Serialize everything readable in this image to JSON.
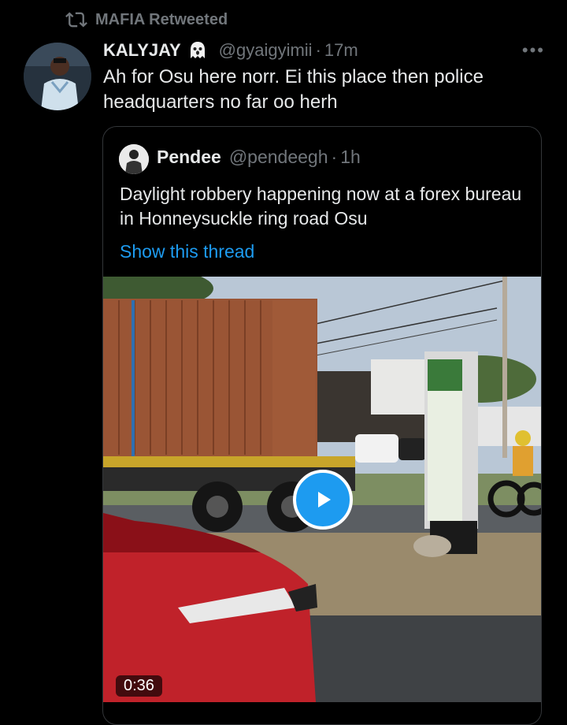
{
  "retweet": {
    "icon": "retweet-icon",
    "label": "MAFIA Retweeted"
  },
  "tweet": {
    "name": "KALYJAY",
    "emoji_icon": "ghost-icon",
    "handle": "@gyaigyimii",
    "separator": "·",
    "time": "17m",
    "more_label": "•••",
    "text": "Ah for Osu here norr. Ei this place then police headquarters no far oo herh"
  },
  "quoted": {
    "name": "Pendee",
    "handle": "@pendeegh",
    "separator": "·",
    "time": "1h",
    "text": "Daylight robbery happening now at a forex bureau in Honneysuckle ring road Osu",
    "thread_link": "Show this thread",
    "media": {
      "play_icon": "play-icon",
      "duration": "0:36"
    }
  },
  "colors": {
    "background": "#000000",
    "text_primary": "#e7e9ea",
    "text_secondary": "#71767b",
    "accent": "#1d9bf0",
    "border": "#333639"
  }
}
